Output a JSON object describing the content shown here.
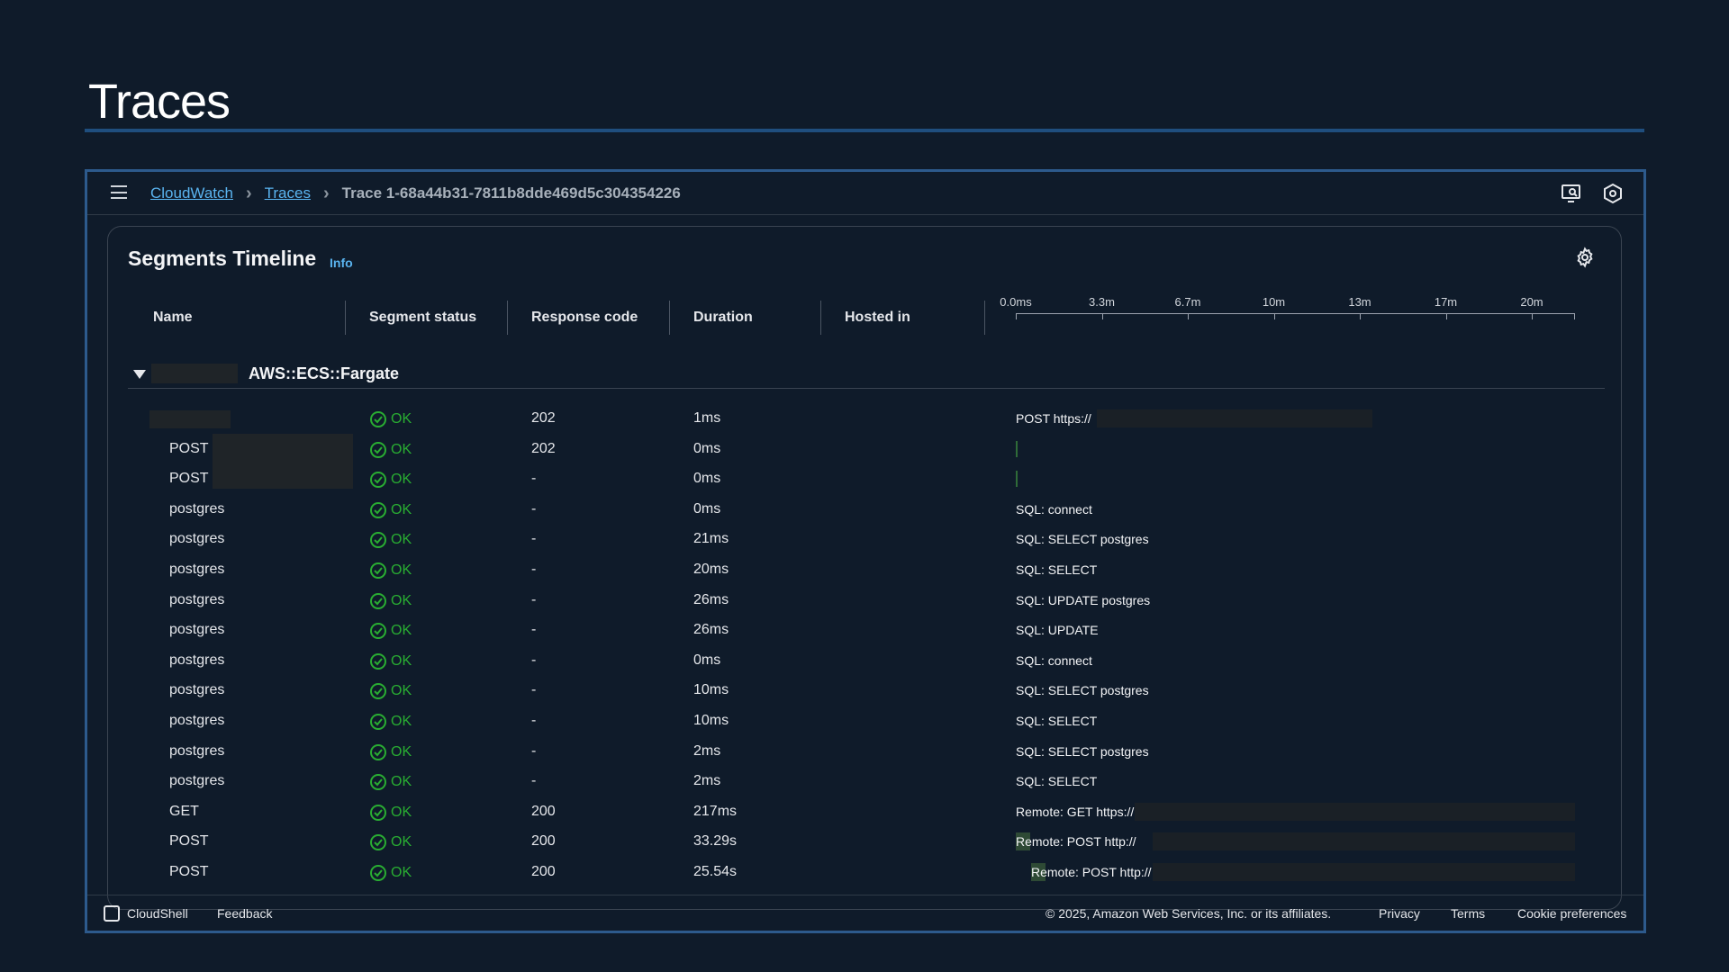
{
  "page": {
    "title": "Traces"
  },
  "breadcrumbs": {
    "cloudwatch": "CloudWatch",
    "traces": "Traces",
    "current": "Trace 1-68a44b31-7811b8dde469d5c304354226"
  },
  "icons": {
    "menu": "hamburger-icon",
    "feedback": "monitor-search-icon",
    "notifications": "settings-hex-icon",
    "settings": "gear-icon",
    "status": "check-circle-icon",
    "shell": "terminal-icon"
  },
  "panel": {
    "title": "Segments Timeline",
    "info": "Info",
    "columns": [
      "Name",
      "Segment status",
      "Response code",
      "Duration",
      "Hosted in"
    ]
  },
  "axis": {
    "ticks": [
      "0.0ms",
      "3.3m",
      "6.7m",
      "10m",
      "13m",
      "17m",
      "20m"
    ]
  },
  "group": {
    "name": "AWS::ECS::Fargate"
  },
  "rows": [
    {
      "name": "",
      "status": "OK",
      "code": "202",
      "duration": "1ms",
      "label": "POST https://"
    },
    {
      "name": "POST",
      "status": "OK",
      "code": "202",
      "duration": "0ms",
      "label": ""
    },
    {
      "name": "POST",
      "status": "OK",
      "code": "-",
      "duration": "0ms",
      "label": ""
    },
    {
      "name": "postgres",
      "status": "OK",
      "code": "-",
      "duration": "0ms",
      "label": "SQL: connect"
    },
    {
      "name": "postgres",
      "status": "OK",
      "code": "-",
      "duration": "21ms",
      "label": "SQL: SELECT postgres"
    },
    {
      "name": "postgres",
      "status": "OK",
      "code": "-",
      "duration": "20ms",
      "label": "SQL: SELECT"
    },
    {
      "name": "postgres",
      "status": "OK",
      "code": "-",
      "duration": "26ms",
      "label": "SQL: UPDATE postgres"
    },
    {
      "name": "postgres",
      "status": "OK",
      "code": "-",
      "duration": "26ms",
      "label": "SQL: UPDATE"
    },
    {
      "name": "postgres",
      "status": "OK",
      "code": "-",
      "duration": "0ms",
      "label": "SQL: connect"
    },
    {
      "name": "postgres",
      "status": "OK",
      "code": "-",
      "duration": "10ms",
      "label": "SQL: SELECT postgres"
    },
    {
      "name": "postgres",
      "status": "OK",
      "code": "-",
      "duration": "10ms",
      "label": "SQL: SELECT"
    },
    {
      "name": "postgres",
      "status": "OK",
      "code": "-",
      "duration": "2ms",
      "label": "SQL: SELECT postgres"
    },
    {
      "name": "postgres",
      "status": "OK",
      "code": "-",
      "duration": "2ms",
      "label": "SQL: SELECT"
    },
    {
      "name": "GET",
      "status": "OK",
      "code": "200",
      "duration": "217ms",
      "label": "Remote: GET https://"
    },
    {
      "name": "POST",
      "status": "OK",
      "code": "200",
      "duration": "33.29s",
      "label": "Remote: POST http://"
    },
    {
      "name": "POST",
      "status": "OK",
      "code": "200",
      "duration": "25.54s",
      "label": "Remote: POST http://"
    }
  ],
  "footer": {
    "cloudshell": "CloudShell",
    "feedback": "Feedback",
    "copyright": "© 2025, Amazon Web Services, Inc. or its affiliates.",
    "privacy": "Privacy",
    "terms": "Terms",
    "cookies": "Cookie preferences"
  },
  "colors": {
    "ok": "#29ad32",
    "link": "#5ab4f0",
    "frame": "#2d5a8c"
  }
}
